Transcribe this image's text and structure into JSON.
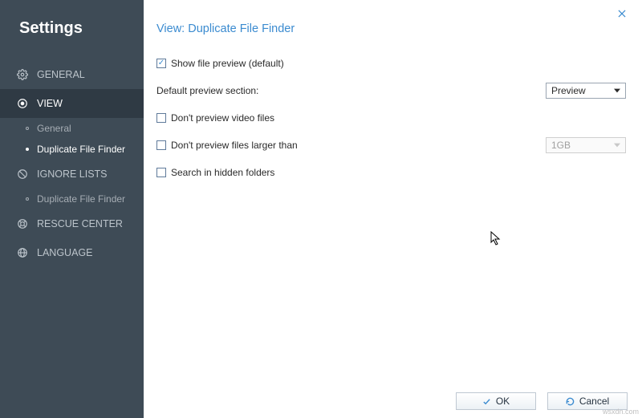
{
  "sidebar": {
    "title": "Settings",
    "items": [
      {
        "label": "GENERAL"
      },
      {
        "label": "VIEW"
      },
      {
        "label": "IGNORE LISTS"
      },
      {
        "label": "RESCUE CENTER"
      },
      {
        "label": "LANGUAGE"
      }
    ],
    "view_sub": [
      {
        "label": "General"
      },
      {
        "label": "Duplicate File Finder"
      }
    ],
    "ignore_sub": [
      {
        "label": "Duplicate File Finder"
      }
    ]
  },
  "main": {
    "title": "View: Duplicate File Finder",
    "show_preview": "Show file preview (default)",
    "default_section_label": "Default preview section:",
    "default_section_value": "Preview",
    "no_video": "Don't preview video files",
    "no_larger": "Don't preview files larger than",
    "size_value": "1GB",
    "search_hidden": "Search in hidden folders"
  },
  "footer": {
    "ok": "OK",
    "cancel": "Cancel"
  },
  "watermark": "wsxdn.com"
}
